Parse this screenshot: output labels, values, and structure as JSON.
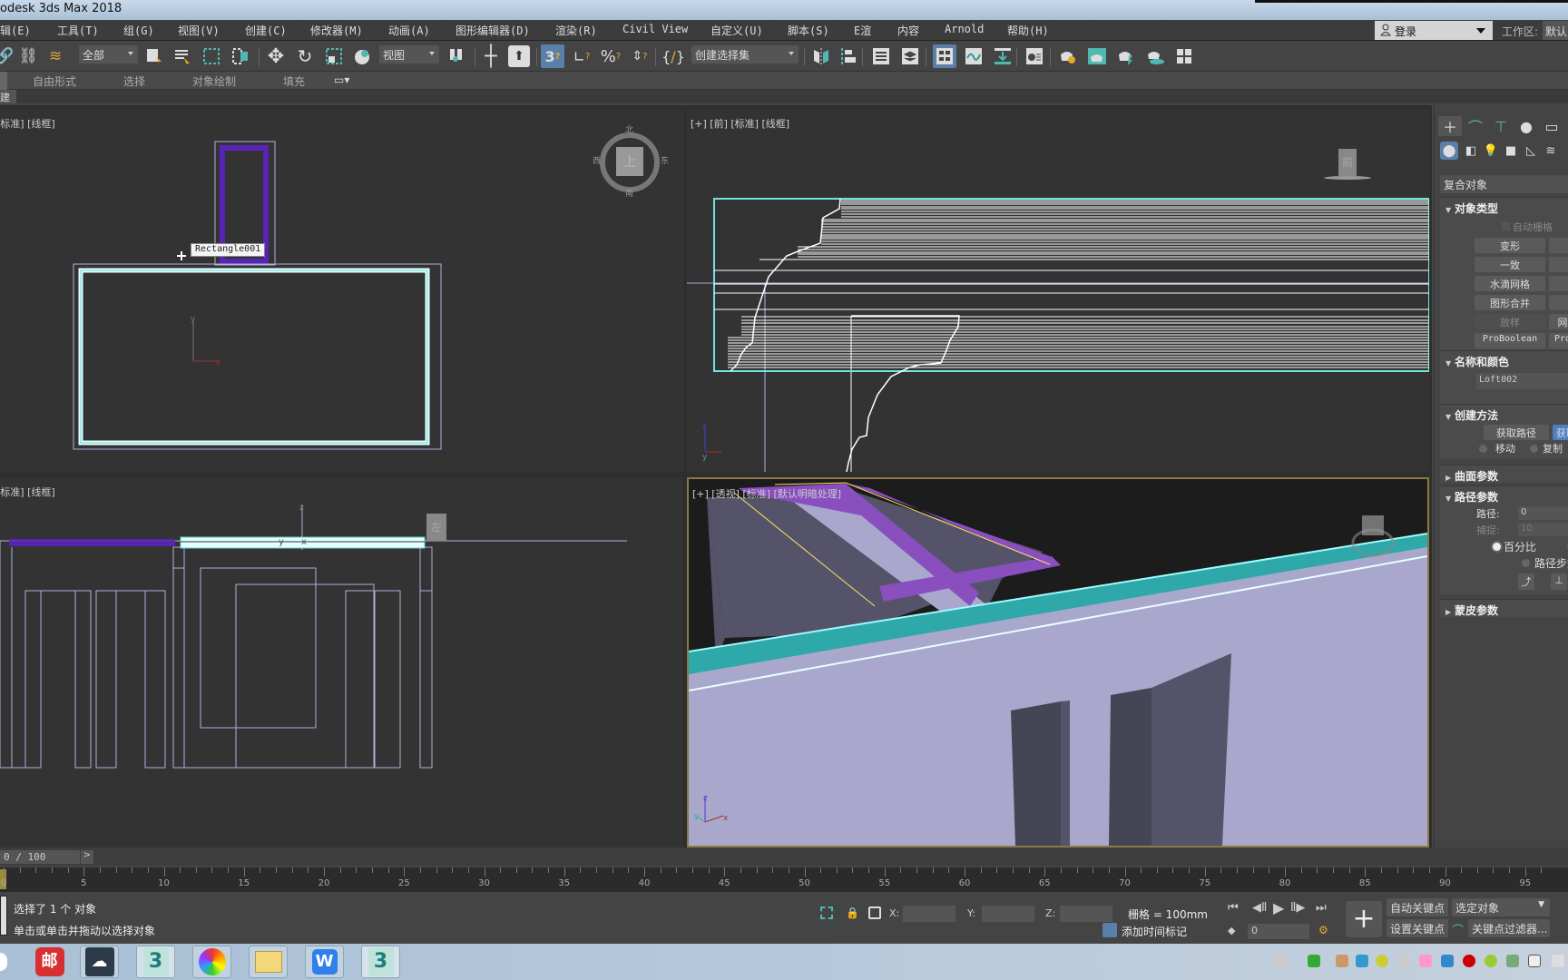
{
  "app": {
    "title": "odesk 3ds Max 2018"
  },
  "menu": {
    "items": [
      "辑(E)",
      "工具(T)",
      "组(G)",
      "视图(V)",
      "创建(C)",
      "修改器(M)",
      "动画(A)",
      "图形编辑器(D)",
      "渲染(R)",
      "Civil View",
      "自定义(U)",
      "脚本(S)",
      "E渲",
      "内容",
      "Arnold",
      "帮助(H)"
    ],
    "login_label": "登录",
    "workspace_label": "工作区:",
    "workspace_value": "默认"
  },
  "toolbar": {
    "selection_filter": "全部",
    "ref_coord": "视图",
    "named_selection_set": "创建选择集"
  },
  "ribbon": {
    "tabs": [
      "自由形式",
      "选择",
      "对象绘制",
      "填充"
    ],
    "active_panel": "建模"
  },
  "viewports": {
    "top": {
      "label": "[标准] [线框]",
      "tooltip": "Rectangle001",
      "viewcube": "上",
      "compass": {
        "n": "北",
        "s": "南",
        "e": "东",
        "w": "西"
      }
    },
    "front": {
      "label": "[+] [前] [标准] [线框]",
      "viewcube": "前"
    },
    "left": {
      "label": "[标准] [线框]",
      "viewcube": "左"
    },
    "perspective": {
      "label": "[+] [透视] [标准] [默认明暗处理]"
    }
  },
  "command_panel": {
    "category": "复合对象",
    "object_type": {
      "title": "对象类型",
      "auto_grid": "自动栅格",
      "buttons": [
        [
          "变形",
          ""
        ],
        [
          "一致",
          ""
        ],
        [
          "水滴网格",
          ""
        ],
        [
          "图形合并",
          ""
        ],
        [
          "放样",
          "网"
        ],
        [
          "ProBoolean",
          "Pro"
        ]
      ]
    },
    "name_color": {
      "title": "名称和颜色",
      "name": "Loft002"
    },
    "creation_method": {
      "title": "创建方法",
      "get_path": "获取路径",
      "get_shape": "获取",
      "move": "移动",
      "copy": "复制"
    },
    "surface_params": {
      "title": "曲面参数"
    },
    "path_params": {
      "title": "路径参数",
      "path_label": "路径:",
      "path_value": "0",
      "snap_label": "捕捉:",
      "snap_value": "10",
      "percentage": "百分比",
      "path_steps": "路径步数"
    },
    "skin_params": {
      "title": "蒙皮参数"
    }
  },
  "timeline": {
    "slider_value": "0 / 100",
    "progress": 0,
    "ticks": [
      "0",
      "5",
      "10",
      "15",
      "20",
      "25",
      "30",
      "35",
      "40",
      "45",
      "50",
      "55",
      "60",
      "65",
      "70",
      "75",
      "80",
      "85",
      "90",
      "95"
    ]
  },
  "status": {
    "selected": "选择了 1 个 对象",
    "prompt": "单击或单击并拖动以选择对象",
    "x_label": "X:",
    "y_label": "Y:",
    "z_label": "Z:",
    "grid": "栅格 = 100mm",
    "add_time_tag": "添加时间标记",
    "current_frame": "0",
    "auto_key": "自动关键点",
    "set_key": "设置关键点",
    "key_target": "选定对象",
    "key_filters": "关键点过滤器..."
  },
  "taskbar": {
    "apps": [
      "邮件",
      "云盘",
      "3ds Max",
      "浏览器",
      "文件资源管理器",
      "WPS",
      "3ds Max"
    ]
  }
}
